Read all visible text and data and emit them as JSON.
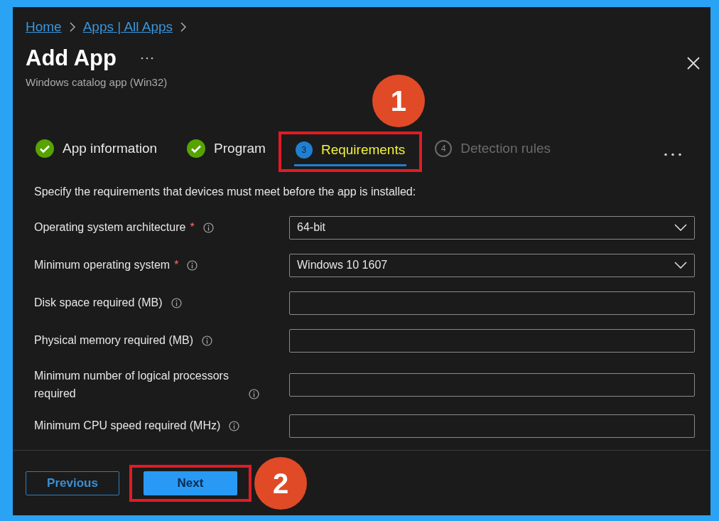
{
  "breadcrumb": [
    "Home",
    "Apps | All Apps"
  ],
  "title": "Add App",
  "subtitle": "Windows catalog app (Win32)",
  "steps": [
    {
      "label": "App information",
      "kind": "done",
      "selected": false,
      "highlighted": false
    },
    {
      "label": "Program",
      "kind": "done",
      "selected": false,
      "highlighted": false
    },
    {
      "label": "Requirements",
      "number": "3",
      "kind": "current",
      "selected": true,
      "highlighted": true,
      "callout": "1"
    },
    {
      "label": "Detection rules",
      "number": "4",
      "kind": "pending",
      "selected": false,
      "highlighted": false
    }
  ],
  "description": "Specify the requirements that devices must meet before the app is installed:",
  "fields": [
    {
      "label": "Operating system architecture",
      "required_marker": "*",
      "kind": "select",
      "value": "64-bit"
    },
    {
      "label": "Minimum operating system",
      "required_marker": "*",
      "kind": "select",
      "value": "Windows 10 1607"
    },
    {
      "label": "Disk space required (MB)",
      "kind": "text"
    },
    {
      "label": "Physical memory required (MB)",
      "kind": "text"
    },
    {
      "label": "Minimum number of logical processors required",
      "kind": "text"
    },
    {
      "label": "Minimum CPU speed required (MHz)",
      "kind": "text"
    }
  ],
  "buttons": [
    {
      "label": "Previous",
      "kind": "secondary",
      "highlighted": false
    },
    {
      "label": "Next",
      "kind": "primary",
      "highlighted": true,
      "callout": "2"
    }
  ]
}
